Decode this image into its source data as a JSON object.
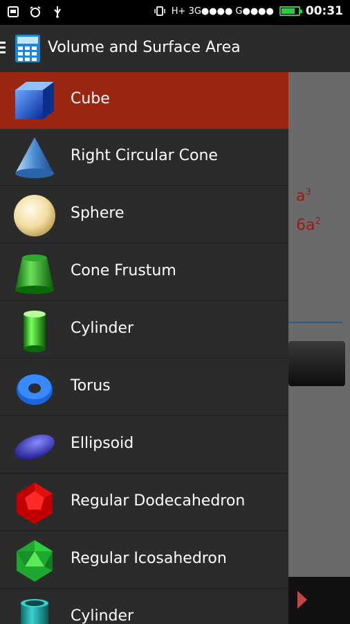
{
  "status_bar": {
    "network_text": "H+ 3G●●●● G●●●●",
    "time": "00:31",
    "battery_level": 0.75
  },
  "app_bar": {
    "title": "Volume and Surface Area"
  },
  "background": {
    "formula_volume_base": "a",
    "formula_volume_exp": "3",
    "formula_area_base": "6a",
    "formula_area_exp": "2"
  },
  "drawer": {
    "items": [
      {
        "label": "Cube",
        "icon": "cube-icon",
        "active": true
      },
      {
        "label": "Right Circular Cone",
        "icon": "cone-icon"
      },
      {
        "label": "Sphere",
        "icon": "sphere-icon"
      },
      {
        "label": "Cone Frustum",
        "icon": "cone-frustum-icon"
      },
      {
        "label": "Cylinder",
        "icon": "cylinder-icon"
      },
      {
        "label": "Torus",
        "icon": "torus-icon"
      },
      {
        "label": "Ellipsoid",
        "icon": "ellipsoid-icon"
      },
      {
        "label": "Regular Dodecahedron",
        "icon": "dodecahedron-icon"
      },
      {
        "label": "Regular Icosahedron",
        "icon": "icosahedron-icon"
      },
      {
        "label": "Cylinder",
        "icon": "hollow-cylinder-icon"
      }
    ]
  },
  "colors": {
    "active_item": "#9b2612",
    "drawer_bg": "#2b2b2b",
    "formula": "#9a1a1a"
  }
}
